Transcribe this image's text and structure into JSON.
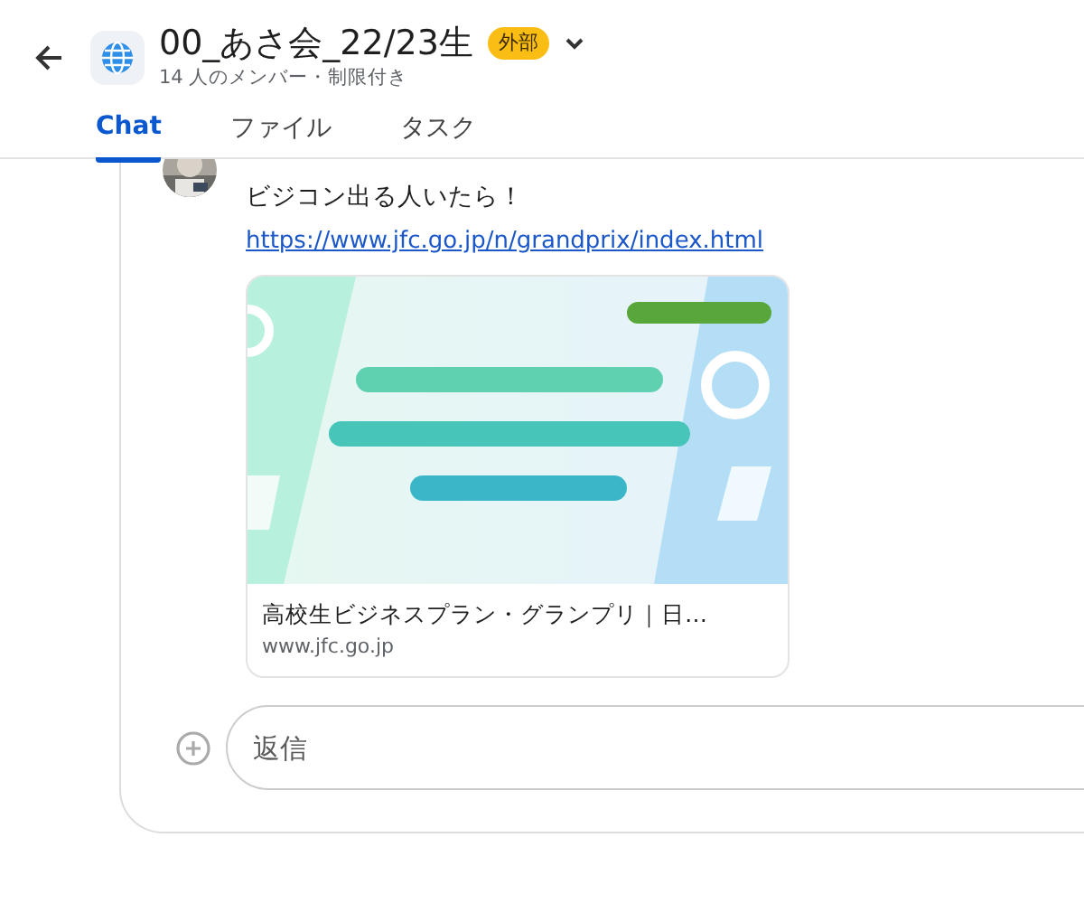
{
  "header": {
    "title": "00_あさ会_22/23生",
    "badge": "外部",
    "subtitle": "14 人のメンバー・制限付き"
  },
  "tabs": [
    {
      "label": "Chat",
      "selected": true
    },
    {
      "label": "ファイル",
      "selected": false
    },
    {
      "label": "タスク",
      "selected": false
    }
  ],
  "messages": [
    {
      "text": "ビジコン出る人いたら！",
      "link": "https://www.jfc.go.jp/n/grandprix/index.html",
      "preview": {
        "title": "高校生ビジネスプラン・グランプリ｜日…",
        "domain": "www.jfc.go.jp"
      }
    }
  ],
  "composer": {
    "placeholder": "返信"
  }
}
